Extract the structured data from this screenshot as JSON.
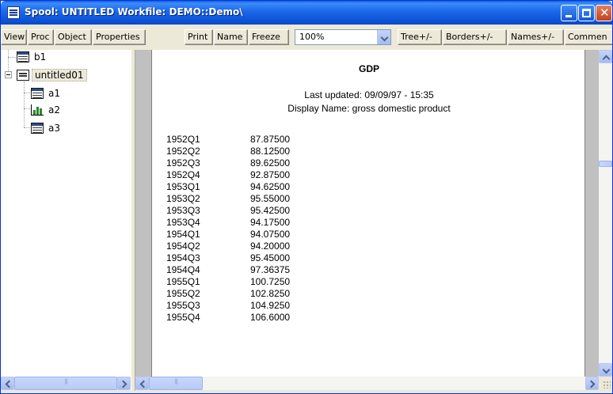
{
  "window": {
    "title": "Spool: UNTITLED   Workfile: DEMO::Demo\\"
  },
  "toolbar": {
    "buttons": [
      "View",
      "Proc",
      "Object",
      "Properties",
      "Print",
      "Name",
      "Freeze"
    ],
    "zoom_value": "100%",
    "right_buttons": [
      "Tree+/-",
      "Borders+/-",
      "Names+/-",
      "Commen"
    ]
  },
  "tree": {
    "items": [
      {
        "label": "b1",
        "icon": "table-icon"
      },
      {
        "label": "untitled01",
        "icon": "spool-icon",
        "selected": true,
        "expanded": true
      },
      {
        "label": "a1",
        "icon": "table-icon"
      },
      {
        "label": "a2",
        "icon": "graph-icon"
      },
      {
        "label": "a3",
        "icon": "table-icon"
      }
    ]
  },
  "document": {
    "title": "GDP",
    "last_updated": "Last updated: 09/09/97 - 15:35",
    "display_name": "Display Name: gross domestic product",
    "rows": [
      [
        "1952Q1",
        "87.87500"
      ],
      [
        "1952Q2",
        "88.12500"
      ],
      [
        "1952Q3",
        "89.62500"
      ],
      [
        "1952Q4",
        "92.87500"
      ],
      [
        "1953Q1",
        "94.62500"
      ],
      [
        "1953Q2",
        "95.55000"
      ],
      [
        "1953Q3",
        "95.42500"
      ],
      [
        "1953Q4",
        "94.17500"
      ],
      [
        "1954Q1",
        "94.07500"
      ],
      [
        "1954Q2",
        "94.20000"
      ],
      [
        "1954Q3",
        "95.45000"
      ],
      [
        "1954Q4",
        "97.36375"
      ],
      [
        "1955Q1",
        "100.7250"
      ],
      [
        "1955Q2",
        "102.8250"
      ],
      [
        "1955Q3",
        "104.9250"
      ],
      [
        "1955Q4",
        "106.6000"
      ]
    ]
  },
  "colors": {
    "titlebar": "#0a5ee7",
    "close_button": "#d45a33",
    "window_bg": "#ece9d8"
  }
}
